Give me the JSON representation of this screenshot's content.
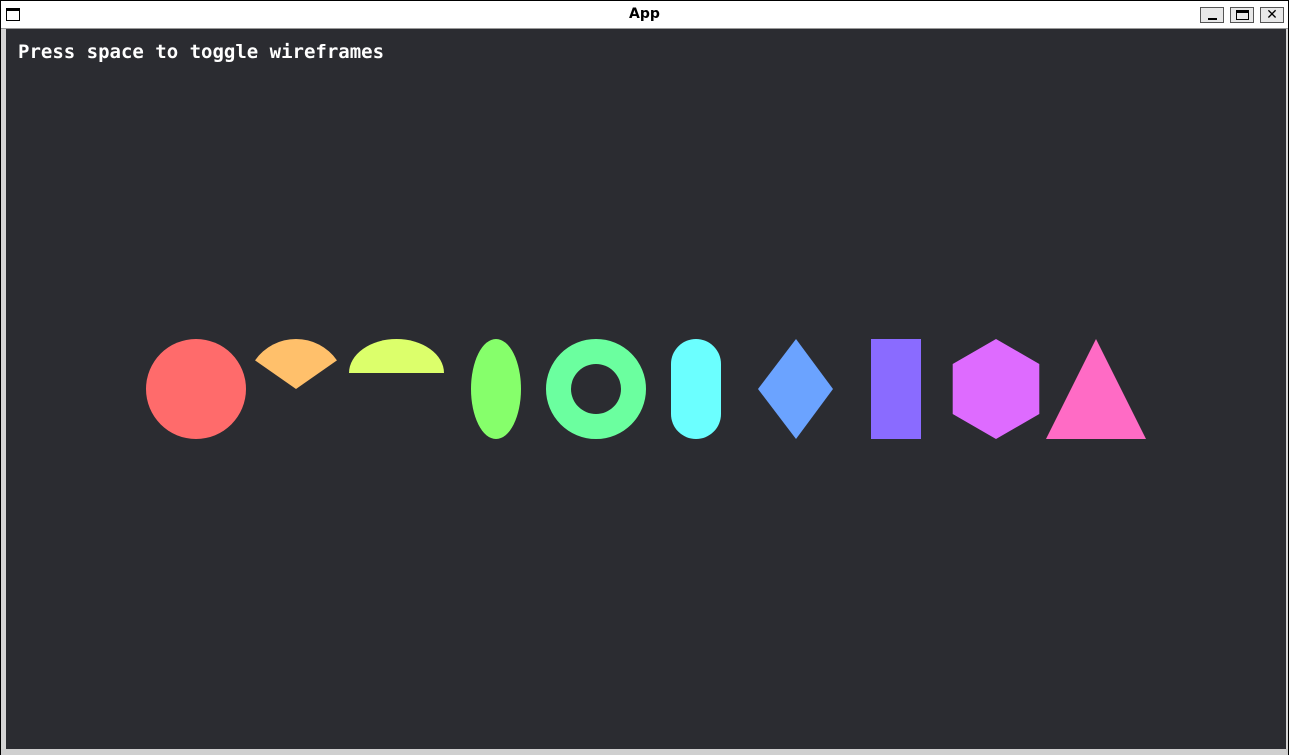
{
  "window": {
    "title": "App"
  },
  "canvas": {
    "hint": "Press space to toggle wireframes"
  },
  "shapes": [
    {
      "name": "circle-shape",
      "color": "#ff6b6b"
    },
    {
      "name": "circular-sector-shape",
      "color": "#ffc06b"
    },
    {
      "name": "semicircle-shape",
      "color": "#dcff6b"
    },
    {
      "name": "ellipse-shape",
      "color": "#86ff6b"
    },
    {
      "name": "annulus-shape",
      "color": "#6bff9f"
    },
    {
      "name": "capsule-shape",
      "color": "#6bffff"
    },
    {
      "name": "rhombus-shape",
      "color": "#6ba3ff"
    },
    {
      "name": "rectangle-shape",
      "color": "#8a6bff"
    },
    {
      "name": "hexagon-shape",
      "color": "#de6bff"
    },
    {
      "name": "triangle-shape",
      "color": "#ff6bc5"
    }
  ],
  "colors": {
    "background": "#2b2c31"
  },
  "icons": {
    "app": "window-icon",
    "minimize": "minimize-icon",
    "maximize": "maximize-icon",
    "close": "close-icon"
  }
}
